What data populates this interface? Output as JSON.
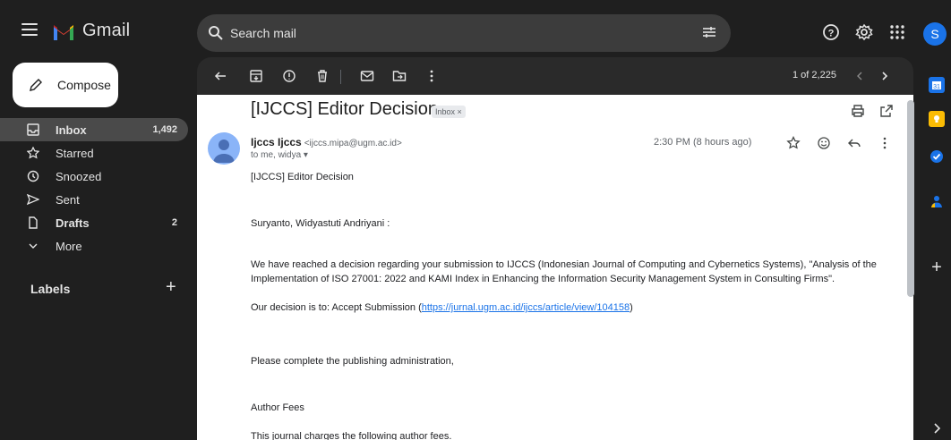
{
  "app": {
    "name": "Gmail",
    "account_initial": "S"
  },
  "search": {
    "placeholder": "Search mail"
  },
  "compose": {
    "label": "Compose"
  },
  "nav": [
    {
      "label": "Inbox",
      "count": "1,492",
      "icon": "inbox-icon",
      "active": true
    },
    {
      "label": "Starred",
      "count": "",
      "icon": "star-icon"
    },
    {
      "label": "Snoozed",
      "count": "",
      "icon": "clock-icon"
    },
    {
      "label": "Sent",
      "count": "",
      "icon": "send-icon"
    },
    {
      "label": "Drafts",
      "count": "2",
      "icon": "draft-icon"
    },
    {
      "label": "More",
      "count": "",
      "icon": "chevron-down-icon"
    }
  ],
  "labels": {
    "title": "Labels"
  },
  "toolbar": {
    "pager": "1 of 2,225"
  },
  "email": {
    "subject": "[IJCCS] Editor Decision",
    "chip": "Inbox ×",
    "sender_name": "Ijccs Ijccs",
    "sender_email": "<ijccs.mipa@ugm.ac.id>",
    "to": "to me, widya ▾",
    "time": "2:30 PM (8 hours ago)",
    "line_subject": "[IJCCS] Editor Decision",
    "greeting": "Suryanto, Widyastuti Andriyani :",
    "paragraph1": "We have reached a decision regarding your submission to IJCCS (Indonesian Journal of Computing and Cybernetics Systems), \"Analysis of the Implementation of ISO 27001: 2022 and KAMI Index in Enhancing the Information Security Management System in Consulting Firms\".",
    "decision_prefix": "Our decision is to: Accept Submission  (",
    "decision_link": "https://jurnal.ugm.ac.id/ijccs/article/view/104158",
    "decision_suffix": ")",
    "admin": "Please complete the publishing administration,",
    "fees_title": "Author Fees",
    "fees_line": "This journal charges the following author fees."
  },
  "colors": {
    "background": "#1f1f1f",
    "search_bg": "#3c3c3c",
    "link": "#1a73e8",
    "avatar": "#1a73e8"
  }
}
